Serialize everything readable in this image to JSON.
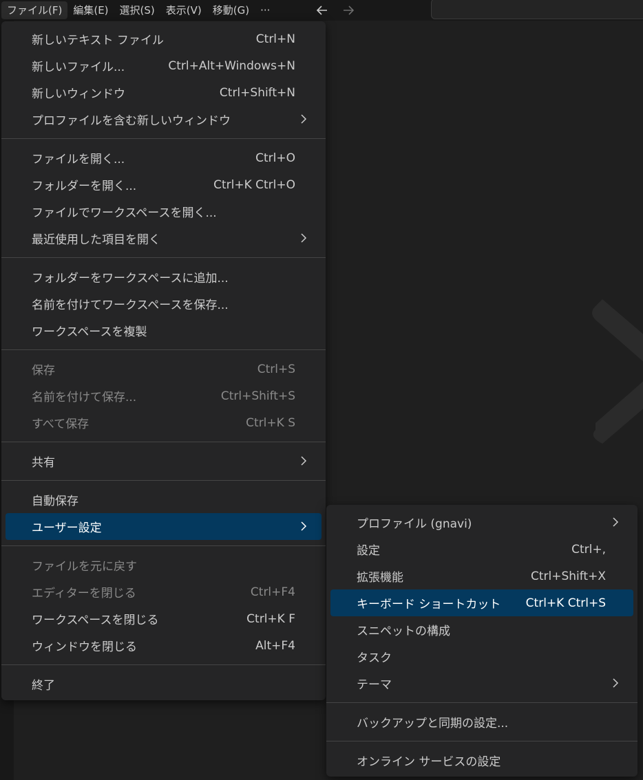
{
  "menubar": {
    "items": [
      {
        "label": "ファイル(F)"
      },
      {
        "label": "編集(E)"
      },
      {
        "label": "選択(S)"
      },
      {
        "label": "表示(V)"
      },
      {
        "label": "移動(G)"
      },
      {
        "label": "···"
      }
    ]
  },
  "file_menu": {
    "new_text_file": {
      "label": "新しいテキスト ファイル",
      "shortcut": "Ctrl+N"
    },
    "new_file": {
      "label": "新しいファイル...",
      "shortcut": "Ctrl+Alt+Windows+N"
    },
    "new_window": {
      "label": "新しいウィンドウ",
      "shortcut": "Ctrl+Shift+N"
    },
    "new_window_profile": {
      "label": "プロファイルを含む新しいウィンドウ"
    },
    "open_file": {
      "label": "ファイルを開く...",
      "shortcut": "Ctrl+O"
    },
    "open_folder": {
      "label": "フォルダーを開く...",
      "shortcut": "Ctrl+K Ctrl+O"
    },
    "open_workspace_from_file": {
      "label": "ファイルでワークスペースを開く..."
    },
    "open_recent": {
      "label": "最近使用した項目を開く"
    },
    "add_folder_to_workspace": {
      "label": "フォルダーをワークスペースに追加..."
    },
    "save_workspace_as": {
      "label": "名前を付けてワークスペースを保存..."
    },
    "duplicate_workspace": {
      "label": "ワークスペースを複製"
    },
    "save": {
      "label": "保存",
      "shortcut": "Ctrl+S"
    },
    "save_as": {
      "label": "名前を付けて保存...",
      "shortcut": "Ctrl+Shift+S"
    },
    "save_all": {
      "label": "すべて保存",
      "shortcut": "Ctrl+K S"
    },
    "share": {
      "label": "共有"
    },
    "auto_save": {
      "label": "自動保存"
    },
    "preferences": {
      "label": "ユーザー設定"
    },
    "revert_file": {
      "label": "ファイルを元に戻す"
    },
    "close_editor": {
      "label": "エディターを閉じる",
      "shortcut": "Ctrl+F4"
    },
    "close_workspace": {
      "label": "ワークスペースを閉じる",
      "shortcut": "Ctrl+K F"
    },
    "close_window": {
      "label": "ウィンドウを閉じる",
      "shortcut": "Alt+F4"
    },
    "exit": {
      "label": "終了"
    }
  },
  "preferences_menu": {
    "profile": {
      "label": "プロファイル (gnavi)"
    },
    "settings": {
      "label": "設定",
      "shortcut": "Ctrl+,"
    },
    "extensions": {
      "label": "拡張機能",
      "shortcut": "Ctrl+Shift+X"
    },
    "keyboard_shortcuts": {
      "label": "キーボード ショートカット",
      "shortcut": "Ctrl+K Ctrl+S"
    },
    "configure_snippets": {
      "label": "スニペットの構成"
    },
    "tasks": {
      "label": "タスク"
    },
    "themes": {
      "label": "テーマ"
    },
    "backup_sync": {
      "label": "バックアップと同期の設定..."
    },
    "online_services": {
      "label": "オンライン サービスの設定"
    }
  },
  "colors": {
    "background": "#1f1f1f",
    "titlebar": "#181818",
    "menu_bg": "#252526",
    "highlight": "#04395e",
    "disabled_text": "#8a8a8a"
  },
  "icons": {
    "back": "arrow-left-icon",
    "forward": "arrow-right-icon",
    "submenu": "chevron-right-icon",
    "watermark": "vscode-logo-icon"
  }
}
